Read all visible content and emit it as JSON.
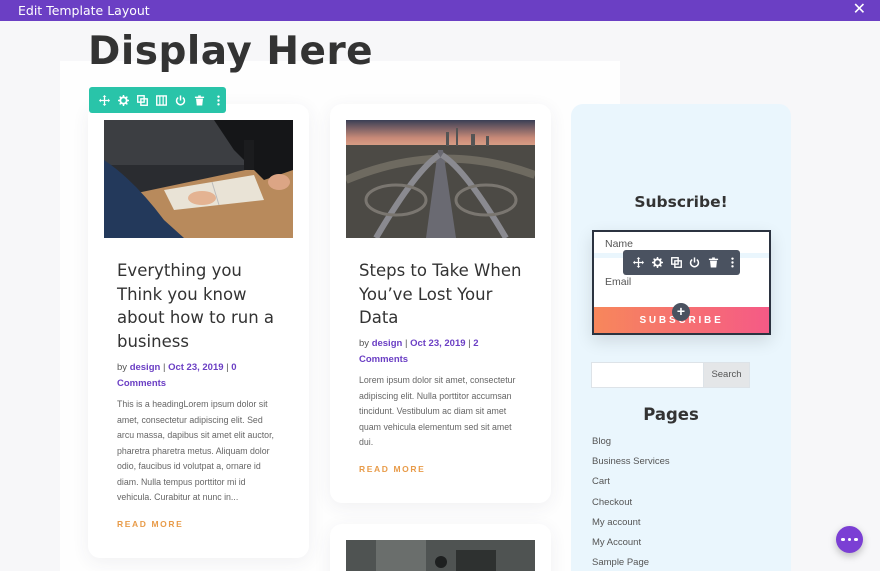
{
  "window": {
    "title": "Edit Template Layout",
    "close_icon": "close-icon"
  },
  "page": {
    "heading": "Display Here"
  },
  "row_toolbar": {
    "icons": [
      "move-icon",
      "gear-icon",
      "duplicate-icon",
      "columns-icon",
      "power-icon",
      "trash-icon",
      "more-icon"
    ],
    "color": "#29c4a9"
  },
  "posts": [
    {
      "title": "Everything you Think you know about how to run a business",
      "meta_prefix": "by ",
      "author": "design",
      "date": "Oct 23, 2019",
      "comments": "0 Comments",
      "excerpt": "This is a headingLorem ipsum dolor sit amet, consectetur adipiscing elit. Sed arcu massa, dapibus sit amet elit auctor, pharetra pharetra metus. Aliquam dolor odio, faucibus id volutpat a, ornare id diam. Nulla tempus porttitor mi id vehicula. Curabitur at nunc in...",
      "read_more": "READ MORE"
    },
    {
      "title": "Steps to Take When You’ve Lost Your Data",
      "meta_prefix": "by ",
      "author": "design",
      "date": "Oct 23, 2019",
      "comments": "2 Comments",
      "excerpt": "Lorem ipsum dolor sit amet, consectetur adipiscing elit. Nulla porttitor accumsan tincidunt. Vestibulum ac diam sit amet quam vehicula elementum sed sit amet dui.",
      "read_more": "READ MORE"
    }
  ],
  "subscribe": {
    "title": "Subscribe!",
    "name_placeholder": "Name",
    "email_placeholder": "Email",
    "button_label": "SUBSCRIBE",
    "add_icon": "plus-icon"
  },
  "module_toolbar": {
    "icons": [
      "move-icon",
      "gear-icon",
      "duplicate-icon",
      "power-icon",
      "trash-icon",
      "more-icon"
    ],
    "color": "#4a5260"
  },
  "search": {
    "value": "",
    "button_label": "Search"
  },
  "pages": {
    "title": "Pages",
    "items": [
      "Blog",
      "Business Services",
      "Cart",
      "Checkout",
      "My account",
      "My Account",
      "Sample Page"
    ]
  },
  "colors": {
    "accent": "#6b3fc4",
    "read_more": "#e89b49",
    "sidebar_bg": "#eaf6fd"
  },
  "fab": {
    "icon": "more-dots-icon"
  }
}
